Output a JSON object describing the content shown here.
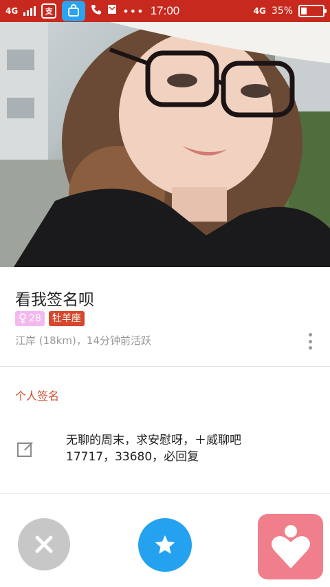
{
  "status_bar": {
    "left_network": "4G",
    "time": "17:00",
    "right_network": "4G",
    "battery_percent_label": "35%",
    "battery_level": 0.35,
    "icons": [
      "signal-icon",
      "alipay-icon",
      "vivo-store-icon",
      "phone-icon",
      "message-icon",
      "more-dots-icon",
      "battery-icon"
    ]
  },
  "profile": {
    "photo_icon": "profile-photo",
    "name": "看我签名呗",
    "age": "28",
    "zodiac": "牡羊座",
    "location": "江岸 (18km)，14分钟前活跃"
  },
  "signature": {
    "title": "个人签名",
    "line1": "无聊的周末，求安慰呀，＋威聊吧",
    "line2": "17717，33680，必回复"
  },
  "actions": {
    "colors": {
      "close": "#c7c7c7",
      "star": "#24a2f0",
      "like": "#f07e8b"
    }
  },
  "colors": {
    "status_bar": "#c8291e",
    "accent": "#cf4b2a"
  }
}
